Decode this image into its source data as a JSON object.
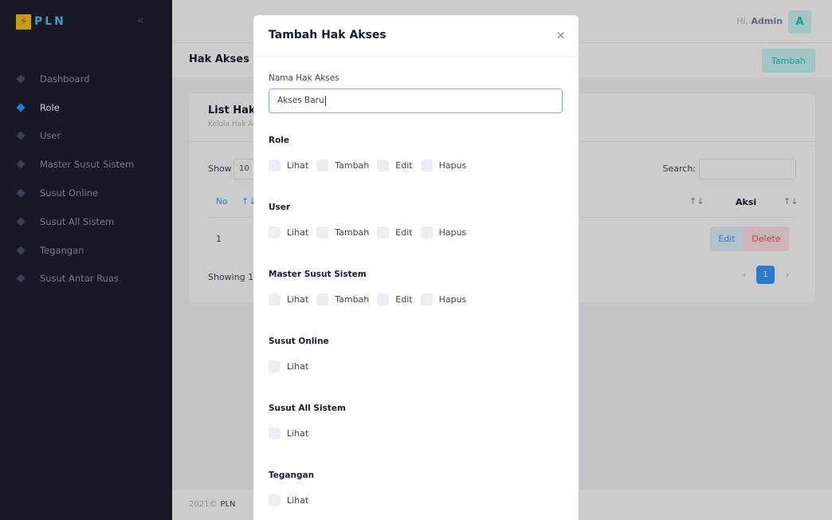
{
  "sidebar": {
    "brand": "PLN",
    "logo_glyph": "⚡",
    "collapse_icon": "«",
    "items": [
      {
        "label": "Dashboard",
        "active": false
      },
      {
        "label": "Role",
        "active": true
      },
      {
        "label": "User",
        "active": false
      },
      {
        "label": "Master Susut Sistem",
        "active": false
      },
      {
        "label": "Susut Online",
        "active": false
      },
      {
        "label": "Susut All Sistem",
        "active": false
      },
      {
        "label": "Tegangan",
        "active": false
      },
      {
        "label": "Susut Antar Ruas",
        "active": false
      }
    ]
  },
  "header": {
    "greeting": "Hi,",
    "user": "Admin",
    "avatar": "A"
  },
  "subheader": {
    "title": "Hak Akses",
    "add_button": "Tambah"
  },
  "card": {
    "title": "List Hak A",
    "subtitle": "Kelola Hak A",
    "show_label": "Show",
    "show_value": "10",
    "search_label": "Search:",
    "col_no": "No",
    "sort_asc": "↑↓",
    "col_aksi": "Aksi",
    "row_no": "1",
    "edit": "Edit",
    "delete": "Delete",
    "showing": "Showing 1 t",
    "page": "1",
    "prev": "‹",
    "next": "›"
  },
  "footer": {
    "copyright": "2021©",
    "org": "PLN"
  },
  "modal": {
    "title": "Tambah Hak Akses",
    "close": "×",
    "name_label": "Nama Hak Akses",
    "name_value": "Akses Baru",
    "sections": [
      {
        "title": "Role",
        "perms": [
          "Lihat",
          "Tambah",
          "Edit",
          "Hapus"
        ]
      },
      {
        "title": "User",
        "perms": [
          "Lihat",
          "Tambah",
          "Edit",
          "Hapus"
        ]
      },
      {
        "title": "Master Susut Sistem",
        "perms": [
          "Lihat",
          "Tambah",
          "Edit",
          "Hapus"
        ]
      },
      {
        "title": "Susut Online",
        "perms": [
          "Lihat"
        ]
      },
      {
        "title": "Susut All Sistem",
        "perms": [
          "Lihat"
        ]
      },
      {
        "title": "Tegangan",
        "perms": [
          "Lihat"
        ]
      }
    ]
  },
  "colors": {
    "sidebar_bg": "#1e1e2d",
    "accent": "#3699ff",
    "success": "#1bc5bd",
    "danger": "#f64e60"
  }
}
